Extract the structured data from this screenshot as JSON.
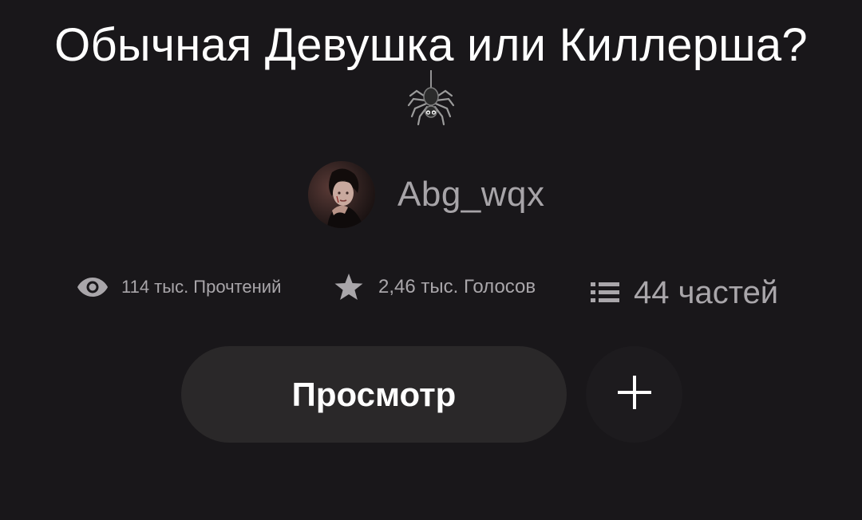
{
  "story": {
    "title": "Обычная Девушка или Киллерша?",
    "title_emoji_icon": "spider-icon"
  },
  "author": {
    "name": "Abg_wqx",
    "avatar_icon": "author-avatar"
  },
  "stats": {
    "reads": {
      "icon": "eye-icon",
      "label": "114 тыс. Прочтений"
    },
    "votes": {
      "icon": "star-icon",
      "label": "2,46 тыс. Голосов"
    },
    "parts": {
      "icon": "list-icon",
      "label": "44 частей"
    }
  },
  "actions": {
    "read_label": "Просмотр",
    "add_icon": "plus-icon"
  },
  "colors": {
    "background": "#19171a",
    "button": "#2a2829",
    "muted_text": "#a9a6aa"
  }
}
